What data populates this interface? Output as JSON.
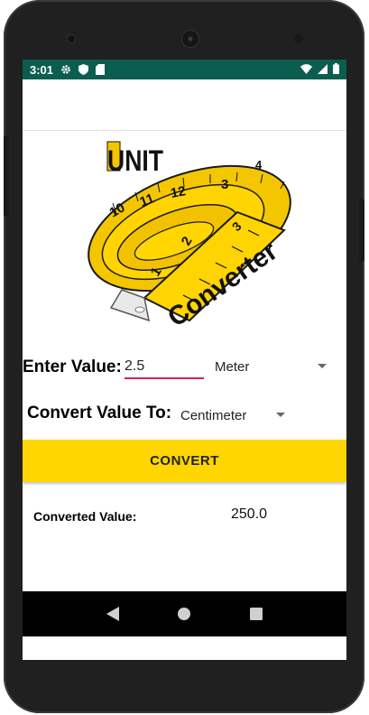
{
  "status_bar": {
    "time": "3:01",
    "icons": [
      "gear-icon",
      "shield-icon",
      "sd-card-icon",
      "wifi-icon",
      "signal-icon",
      "battery-icon"
    ]
  },
  "logo": {
    "word1": "UNIT",
    "word2": "Converter",
    "tape_numbers": [
      "10",
      "11",
      "12",
      "3",
      "4",
      "2",
      "1",
      "3"
    ]
  },
  "form": {
    "enter_label": "Enter Value:",
    "input_value": "2.5",
    "from_unit": "Meter",
    "convert_label": "Convert Value To:",
    "to_unit": "Centimeter"
  },
  "convert_button": "CONVERT",
  "result": {
    "label": "Converted Value:",
    "value": "250.0"
  },
  "colors": {
    "status_bar": "#0b5d4f",
    "accent": "#ffd600",
    "input_underline": "#d81b60"
  },
  "nav": [
    "back-icon",
    "home-icon",
    "recents-icon"
  ]
}
